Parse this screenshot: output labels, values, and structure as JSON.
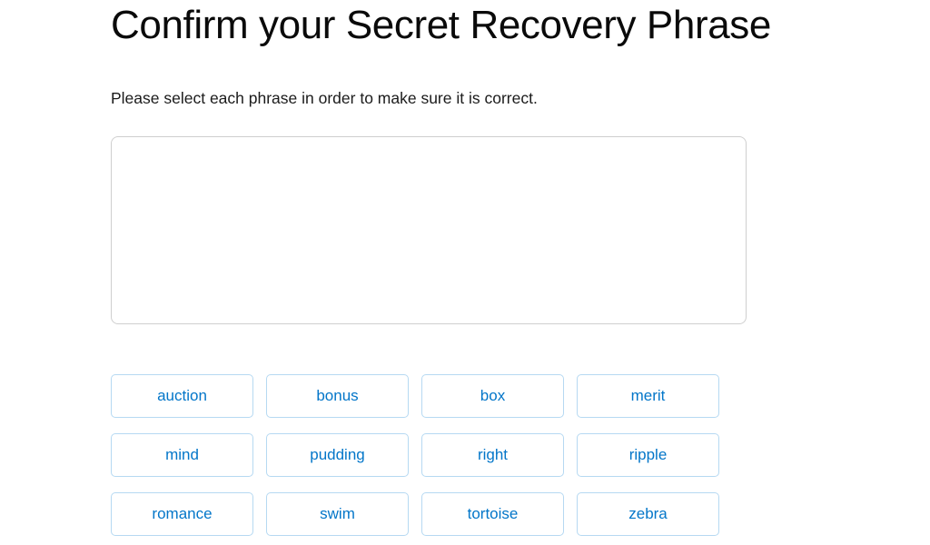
{
  "header": {
    "title": "Confirm your Secret Recovery Phrase",
    "subtitle": "Please select each phrase in order to make sure it is correct."
  },
  "dropzone": {
    "name": "selected-phrase-dropzone",
    "selected_words": [],
    "border_color": "#cfcfcf"
  },
  "word_bank": {
    "accent_color": "#0376c9",
    "border_color": "#b6d9f2",
    "words": [
      "auction",
      "bonus",
      "box",
      "merit",
      "mind",
      "pudding",
      "right",
      "ripple",
      "romance",
      "swim",
      "tortoise",
      "zebra"
    ]
  }
}
